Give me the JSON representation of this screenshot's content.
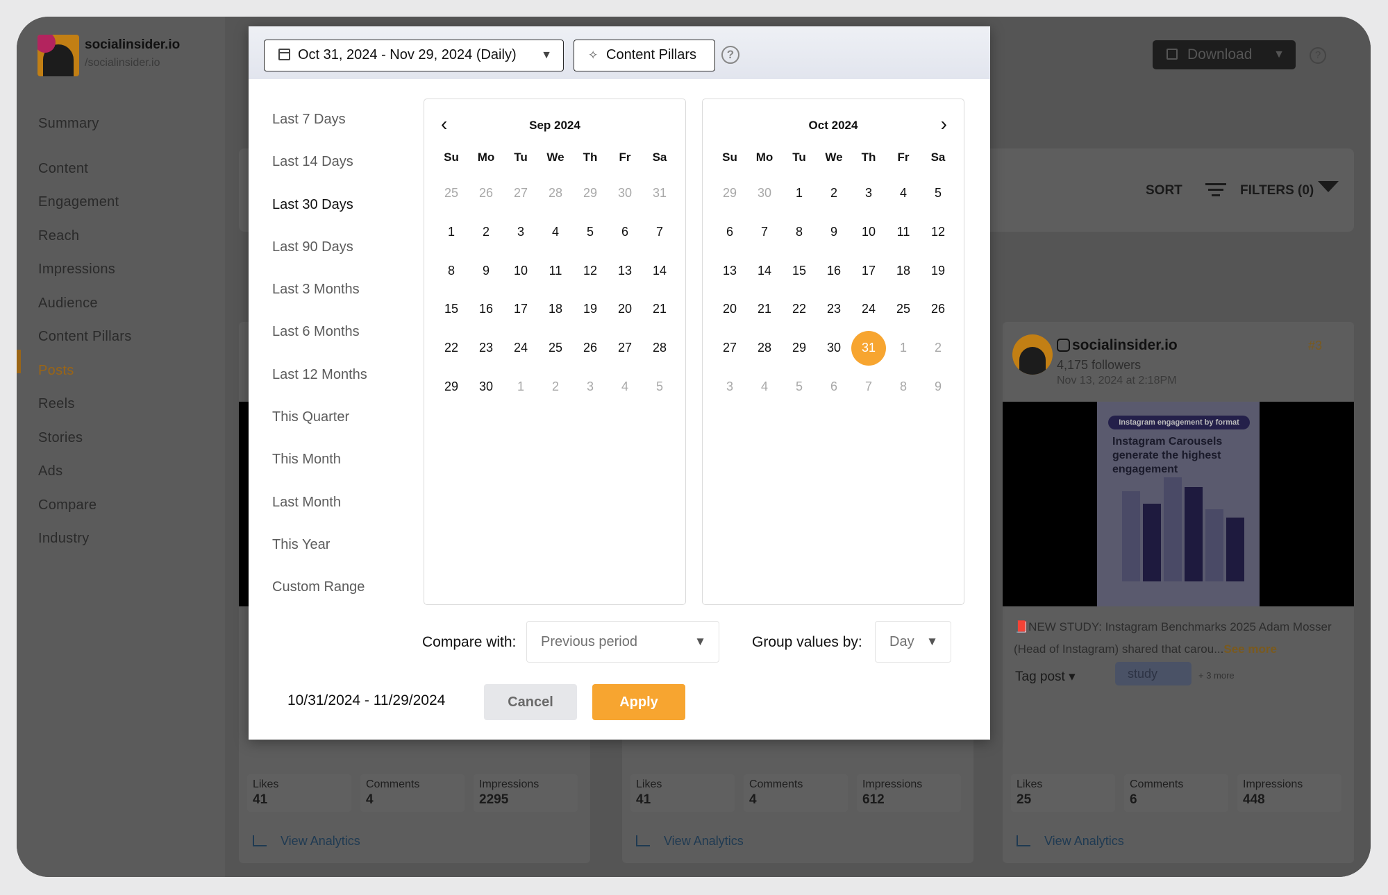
{
  "brand": {
    "name": "socialinsider.io",
    "handle": "/socialinsider.io"
  },
  "sidebar": {
    "items": [
      "Summary",
      "Content",
      "Engagement",
      "Reach",
      "Impressions",
      "Audience",
      "Content Pillars",
      "Posts",
      "Reels",
      "Stories",
      "Ads",
      "Compare",
      "Industry"
    ],
    "active": "Posts"
  },
  "toolbar": {
    "download": "Download",
    "sort": "SORT",
    "filters": "FILTERS (0)"
  },
  "posts": [
    {
      "likes": "41",
      "comments": "4",
      "impressions": "2295"
    },
    {
      "likes": "41",
      "comments": "4",
      "impressions": "612"
    },
    {
      "account": "socialinsider.io",
      "followers": "4,175 followers",
      "date": "Nov 13, 2024 at 2:18PM",
      "rank": "#3",
      "infographic_tag": "Instagram engagement by format",
      "infographic_headline": "Instagram Carousels generate the highest engagement",
      "caption": "📕NEW STUDY: Instagram Benchmarks 2025 Adam Mosser (Head of Instagram) shared that carou...",
      "see_more": "See more",
      "tag_post": "Tag post",
      "tag": "study",
      "tag_more": "+ 3 more",
      "likes": "25",
      "comments": "6",
      "impressions": "448"
    }
  ],
  "metric_labels": {
    "likes": "Likes",
    "comments": "Comments",
    "impressions": "Impressions",
    "view": "View Analytics"
  },
  "modal": {
    "date_button": "Oct 31, 2024 - Nov 29, 2024 (Daily)",
    "pillars_button": "Content Pillars",
    "help": "?",
    "presets": [
      "Last 7 Days",
      "Last 14 Days",
      "Last 30 Days",
      "Last 90 Days",
      "Last 3 Months",
      "Last 6 Months",
      "Last 12 Months",
      "This Quarter",
      "This Month",
      "Last Month",
      "This Year",
      "Custom Range"
    ],
    "selected_preset": "Last 30 Days",
    "weekdays": [
      "Su",
      "Mo",
      "Tu",
      "We",
      "Th",
      "Fr",
      "Sa"
    ],
    "calendars": [
      {
        "title": "Sep 2024",
        "days": [
          [
            "25",
            "out"
          ],
          [
            "26",
            "out"
          ],
          [
            "27",
            "out"
          ],
          [
            "28",
            "out"
          ],
          [
            "29",
            "out"
          ],
          [
            "30",
            "out"
          ],
          [
            "31",
            "out"
          ],
          [
            "1",
            ""
          ],
          [
            "2",
            ""
          ],
          [
            "3",
            ""
          ],
          [
            "4",
            ""
          ],
          [
            "5",
            ""
          ],
          [
            "6",
            ""
          ],
          [
            "7",
            ""
          ],
          [
            "8",
            ""
          ],
          [
            "9",
            ""
          ],
          [
            "10",
            ""
          ],
          [
            "11",
            ""
          ],
          [
            "12",
            ""
          ],
          [
            "13",
            ""
          ],
          [
            "14",
            ""
          ],
          [
            "15",
            ""
          ],
          [
            "16",
            ""
          ],
          [
            "17",
            ""
          ],
          [
            "18",
            ""
          ],
          [
            "19",
            ""
          ],
          [
            "20",
            ""
          ],
          [
            "21",
            ""
          ],
          [
            "22",
            ""
          ],
          [
            "23",
            ""
          ],
          [
            "24",
            ""
          ],
          [
            "25",
            ""
          ],
          [
            "26",
            ""
          ],
          [
            "27",
            ""
          ],
          [
            "28",
            ""
          ],
          [
            "29",
            ""
          ],
          [
            "30",
            ""
          ],
          [
            "1",
            "out"
          ],
          [
            "2",
            "out"
          ],
          [
            "3",
            "out"
          ],
          [
            "4",
            "out"
          ],
          [
            "5",
            "out"
          ]
        ]
      },
      {
        "title": "Oct 2024",
        "days": [
          [
            "29",
            "out"
          ],
          [
            "30",
            "out"
          ],
          [
            "1",
            ""
          ],
          [
            "2",
            ""
          ],
          [
            "3",
            ""
          ],
          [
            "4",
            ""
          ],
          [
            "5",
            ""
          ],
          [
            "6",
            ""
          ],
          [
            "7",
            ""
          ],
          [
            "8",
            ""
          ],
          [
            "9",
            ""
          ],
          [
            "10",
            ""
          ],
          [
            "11",
            ""
          ],
          [
            "12",
            ""
          ],
          [
            "13",
            ""
          ],
          [
            "14",
            ""
          ],
          [
            "15",
            ""
          ],
          [
            "16",
            ""
          ],
          [
            "17",
            ""
          ],
          [
            "18",
            ""
          ],
          [
            "19",
            ""
          ],
          [
            "20",
            ""
          ],
          [
            "21",
            ""
          ],
          [
            "22",
            ""
          ],
          [
            "23",
            ""
          ],
          [
            "24",
            ""
          ],
          [
            "25",
            ""
          ],
          [
            "26",
            ""
          ],
          [
            "27",
            ""
          ],
          [
            "28",
            ""
          ],
          [
            "29",
            ""
          ],
          [
            "30",
            ""
          ],
          [
            "31",
            "sel"
          ],
          [
            "1",
            "out"
          ],
          [
            "2",
            "out"
          ],
          [
            "3",
            "out"
          ],
          [
            "4",
            "out"
          ],
          [
            "5",
            "out"
          ],
          [
            "6",
            "out"
          ],
          [
            "7",
            "out"
          ],
          [
            "8",
            "out"
          ],
          [
            "9",
            "out"
          ]
        ]
      }
    ],
    "compare_label": "Compare with:",
    "compare_value": "Previous period",
    "group_label": "Group values by:",
    "group_value": "Day",
    "range_text": "10/31/2024 - 11/29/2024",
    "cancel": "Cancel",
    "apply": "Apply",
    "accent_color": "#f7a530"
  }
}
